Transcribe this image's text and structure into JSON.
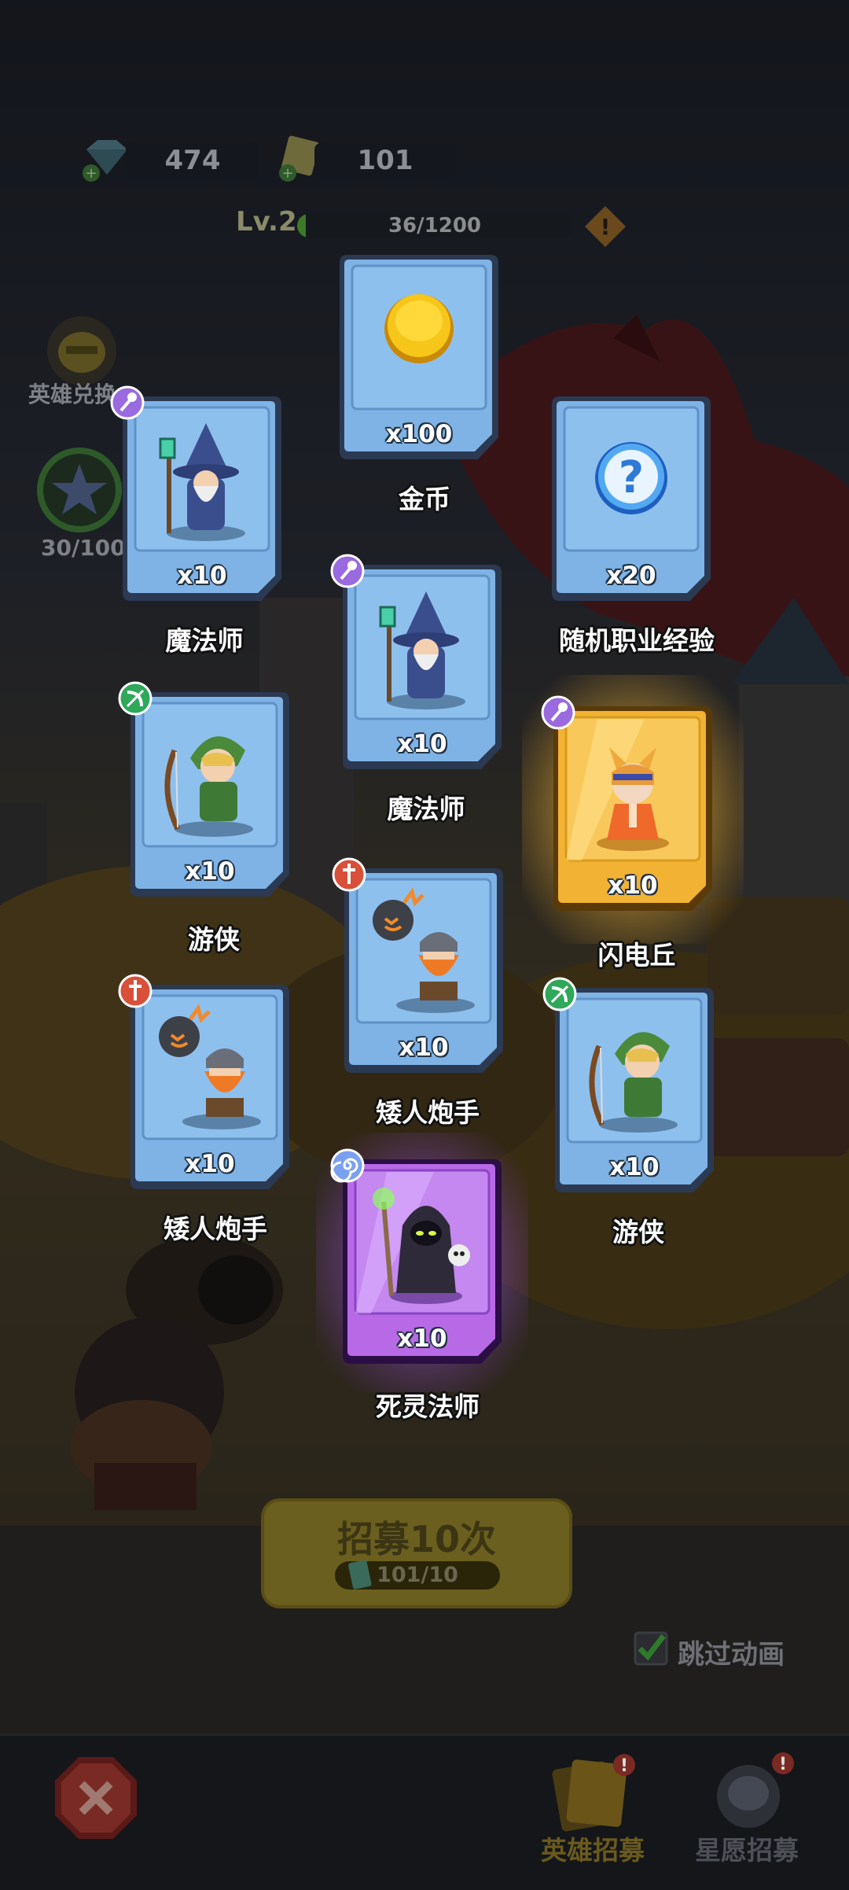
{
  "currency": {
    "diamonds": "474",
    "tickets": "101"
  },
  "level": {
    "label": "Lv.2",
    "progress_text": "36/1200",
    "progress_fraction": 0.03
  },
  "side": {
    "hero_exchange_label": "英雄兑换",
    "star_progress": "30/100"
  },
  "rewards": [
    {
      "qty": "x100",
      "name": "金币",
      "art": "gold-coin-icon",
      "class_icon": ""
    },
    {
      "qty": "x10",
      "name": "魔法师",
      "art": "wizard-hero",
      "class_icon": "staff-class-icon"
    },
    {
      "qty": "x20",
      "name": "随机职业经验",
      "art": "question-orb-icon",
      "class_icon": ""
    },
    {
      "qty": "x10",
      "name": "魔法师",
      "art": "wizard-hero",
      "class_icon": "staff-class-icon"
    },
    {
      "qty": "x10",
      "name": "游侠",
      "art": "ranger-hero",
      "class_icon": "bow-class-icon"
    },
    {
      "qty": "x10",
      "name": "闪电丘",
      "art": "fox-girl-hero",
      "class_icon": "staff-class-icon"
    },
    {
      "qty": "x10",
      "name": "矮人炮手",
      "art": "dwarf-gunner-hero",
      "class_icon": "sword-class-icon"
    },
    {
      "qty": "x10",
      "name": "矮人炮手",
      "art": "dwarf-gunner-hero",
      "class_icon": "sword-class-icon"
    },
    {
      "qty": "x10",
      "name": "游侠",
      "art": "ranger-hero",
      "class_icon": "bow-class-icon"
    },
    {
      "qty": "x10",
      "name": "死灵法师",
      "art": "necromancer-hero",
      "class_icon": "spiral-class-icon"
    }
  ],
  "recruit": {
    "label": "招募10次",
    "count": "101/10"
  },
  "skip_animation": {
    "label": "跳过动画",
    "checked": true
  },
  "bottom_tabs": [
    {
      "label": "英雄招募",
      "active": true
    },
    {
      "label": "星愿招募",
      "active": false
    }
  ],
  "colors": {
    "blue_card": "#7fb3e6",
    "gold_card": "#f2b233",
    "purple_card": "#b86ae6"
  }
}
